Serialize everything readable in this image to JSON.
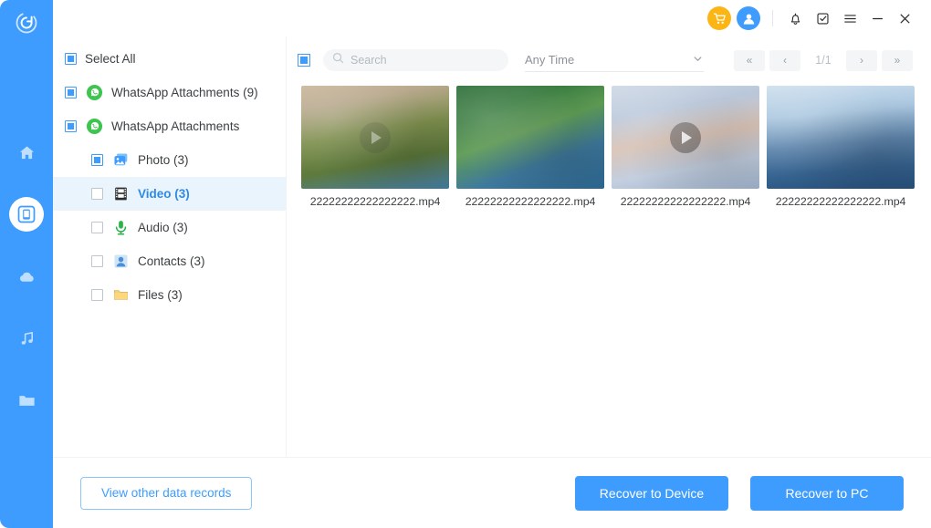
{
  "titlebar": {
    "cart_icon": "cart-icon",
    "user_icon": "user-avatar-icon",
    "bell_icon": "bell-icon",
    "feedback_icon": "feedback-icon",
    "menu_icon": "hamburger-menu-icon",
    "minimize_icon": "minimize-icon",
    "close_icon": "close-icon"
  },
  "rail": {
    "logo": "app-logo",
    "items": [
      {
        "name": "home-icon",
        "active": false
      },
      {
        "name": "device-icon",
        "active": true
      },
      {
        "name": "cloud-icon",
        "active": false
      },
      {
        "name": "music-icon",
        "active": false
      },
      {
        "name": "folder-icon",
        "active": false
      }
    ]
  },
  "tree": {
    "select_all_label": "Select All",
    "items": [
      {
        "label": "WhatsApp Attachments (9)",
        "icon": "whatsapp-icon",
        "level": 1,
        "checkbox": "partial",
        "selected": false
      },
      {
        "label": "WhatsApp Attachments",
        "icon": "whatsapp-icon",
        "level": 1,
        "checkbox": "partial",
        "selected": false
      },
      {
        "label": "Photo (3)",
        "icon": "photo-icon",
        "level": 2,
        "checkbox": "partial",
        "selected": false
      },
      {
        "label": "Video (3)",
        "icon": "video-icon",
        "level": 2,
        "checkbox": "empty",
        "selected": true
      },
      {
        "label": "Audio (3)",
        "icon": "audio-icon",
        "level": 2,
        "checkbox": "empty",
        "selected": false
      },
      {
        "label": "Contacts (3)",
        "icon": "contacts-icon",
        "level": 2,
        "checkbox": "empty",
        "selected": false
      },
      {
        "label": "Files (3)",
        "icon": "files-icon",
        "level": 2,
        "checkbox": "empty",
        "selected": false
      }
    ]
  },
  "toolbar": {
    "select_checkbox": "select-all-results-checkbox",
    "search_placeholder": "Search",
    "search_value": "",
    "time_filter_value": "Any Time",
    "pager": {
      "first_label": "«",
      "prev_label": "‹",
      "page_label": "1/1",
      "next_label": "›",
      "last_label": "»"
    }
  },
  "grid": {
    "items": [
      {
        "filename": "22222222222222222.mp4",
        "thumb_class": "img-a",
        "play_overlay": "faint"
      },
      {
        "filename": "22222222222222222.mp4",
        "thumb_class": "img-b",
        "play_overlay": "none"
      },
      {
        "filename": "22222222222222222.mp4",
        "thumb_class": "img-c",
        "play_overlay": "strong"
      },
      {
        "filename": "22222222222222222.mp4",
        "thumb_class": "img-d",
        "play_overlay": "none"
      }
    ]
  },
  "footer": {
    "view_other_label": "View other data records",
    "recover_device_label": "Recover to Device",
    "recover_pc_label": "Recover to PC"
  },
  "colors": {
    "brand_blue": "#3d9cfd",
    "cart_yellow": "#fbb616",
    "selected_row_bg": "#eaf4fd",
    "selected_text": "#2e8ae6",
    "whatsapp_green": "#3fc451"
  }
}
